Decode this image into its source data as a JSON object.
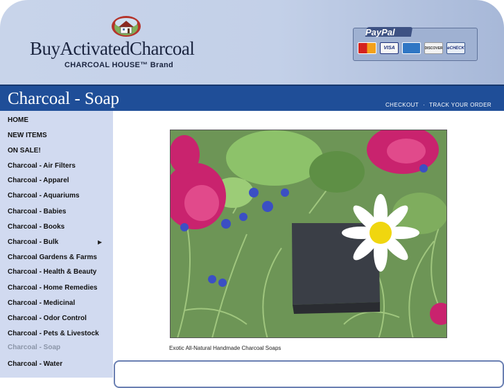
{
  "header": {
    "brand_name": "BuyActivatedCharcoal",
    "brand_sub": "CHARCOAL HOUSE™ Brand",
    "paypal_label": "PayPal",
    "payment_cards": [
      "MasterCard",
      "VISA",
      "AMEX",
      "DISCOVER",
      "eCHECK"
    ]
  },
  "titlebar": {
    "page_title": "Charcoal - Soap",
    "checkout": "CHECKOUT",
    "separator": "·",
    "track_order": "TRACK YOUR ORDER"
  },
  "sidebar": {
    "items": [
      {
        "label": "HOME"
      },
      {
        "label": "NEW ITEMS"
      },
      {
        "label": "ON SALE!"
      },
      {
        "label": "Charcoal - Air Filters"
      },
      {
        "label": "Charcoal - Apparel"
      },
      {
        "label": "Charcoal - Aquariums"
      },
      {
        "label": "Charcoal - Babies"
      },
      {
        "label": "Charcoal - Books"
      },
      {
        "label": "Charcoal - Bulk"
      },
      {
        "label": "Charcoal Gardens & Farms"
      },
      {
        "label": "Charcoal - Health & Beauty"
      },
      {
        "label": "Charcoal - Home Remedies"
      },
      {
        "label": "Charcoal - Medicinal"
      },
      {
        "label": "Charcoal - Odor Control"
      },
      {
        "label": "Charcoal - Pets & Livestock"
      },
      {
        "label": "Charcoal - Soap"
      },
      {
        "label": "Charcoal - Water"
      }
    ],
    "active_item": "Charcoal - Soap",
    "submenu_arrow": "▶"
  },
  "main": {
    "caption": "Exotic All-Natural Handmade Charcoal Soaps"
  },
  "colors": {
    "titlebar": "#1f4e98",
    "sidebar": "#d1daf0",
    "header": "#c8d4ea"
  },
  "icons": [
    "house-logo-icon",
    "submenu-arrow-icon"
  ]
}
